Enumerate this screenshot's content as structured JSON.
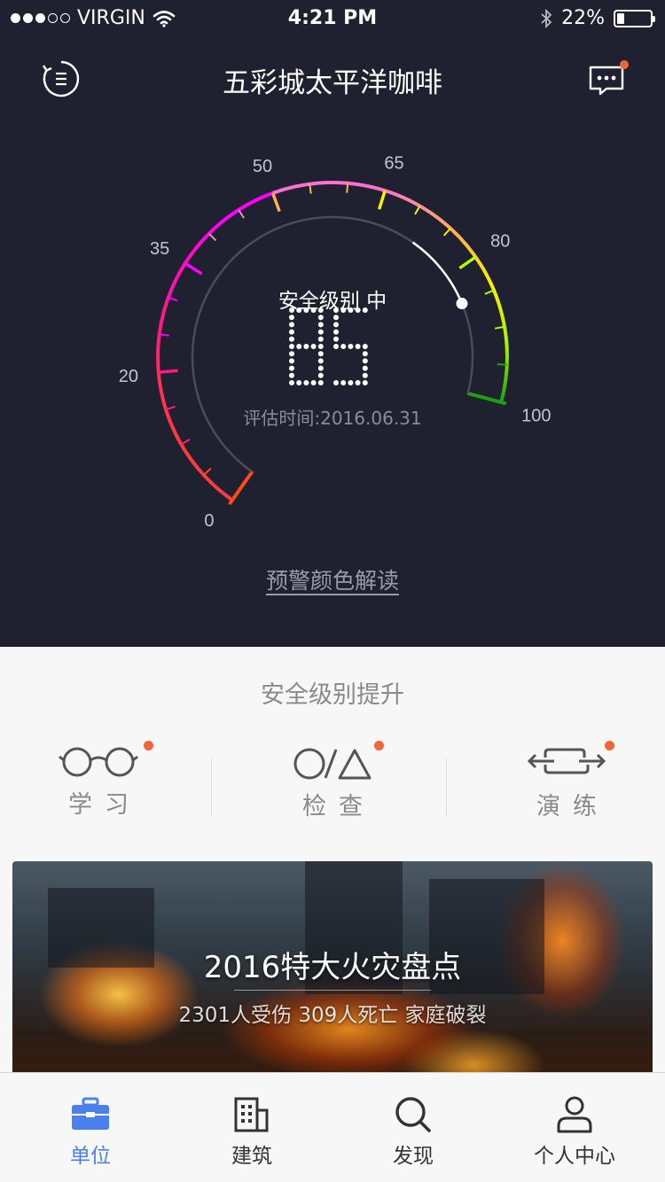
{
  "status_bar": {
    "carrier": "VIRGIN",
    "signal_bars": 5,
    "signal_filled": 3,
    "time": "4:21 PM",
    "battery": "22%",
    "battery_level": 0.22
  },
  "nav": {
    "title": "五彩城太平洋咖啡",
    "menu_icon": "list-circle-icon",
    "message_icon": "chat-bubble-icon",
    "message_badge": true
  },
  "gauge": {
    "min": 0,
    "max": 100,
    "ticks": [
      "0",
      "20",
      "35",
      "50",
      "65",
      "80",
      "100"
    ],
    "value": 85,
    "level_label": "安全级别 中",
    "score": "85",
    "eval_time": "评估时间:2016.06.31",
    "colors": [
      "#ff4a10",
      "#ff1a80",
      "#ff00ff",
      "#ff88cc",
      "#ffb050",
      "#fff000",
      "#b0ff00",
      "#1ea010"
    ]
  },
  "legend_link": "预警颜色解读",
  "section_title": "安全级别提升",
  "actions": [
    {
      "label": "学习",
      "icon": "glasses-icon",
      "badge": true
    },
    {
      "label": "检查",
      "icon": "circle-slash-triangle-icon",
      "badge": true
    },
    {
      "label": "演练",
      "icon": "swap-arrows-icon",
      "badge": true
    }
  ],
  "banner": {
    "title": "2016特大火灾盘点",
    "subtitle": "2301人受伤 309人死亡 家庭破裂"
  },
  "tabs": [
    {
      "label": "单位",
      "icon": "briefcase-icon",
      "active": true
    },
    {
      "label": "建筑",
      "icon": "building-icon",
      "active": false
    },
    {
      "label": "发现",
      "icon": "search-icon",
      "active": false
    },
    {
      "label": "个人中心",
      "icon": "user-icon",
      "active": false
    }
  ],
  "accent_color": "#4a80ee",
  "badge_color": "#f0663a"
}
